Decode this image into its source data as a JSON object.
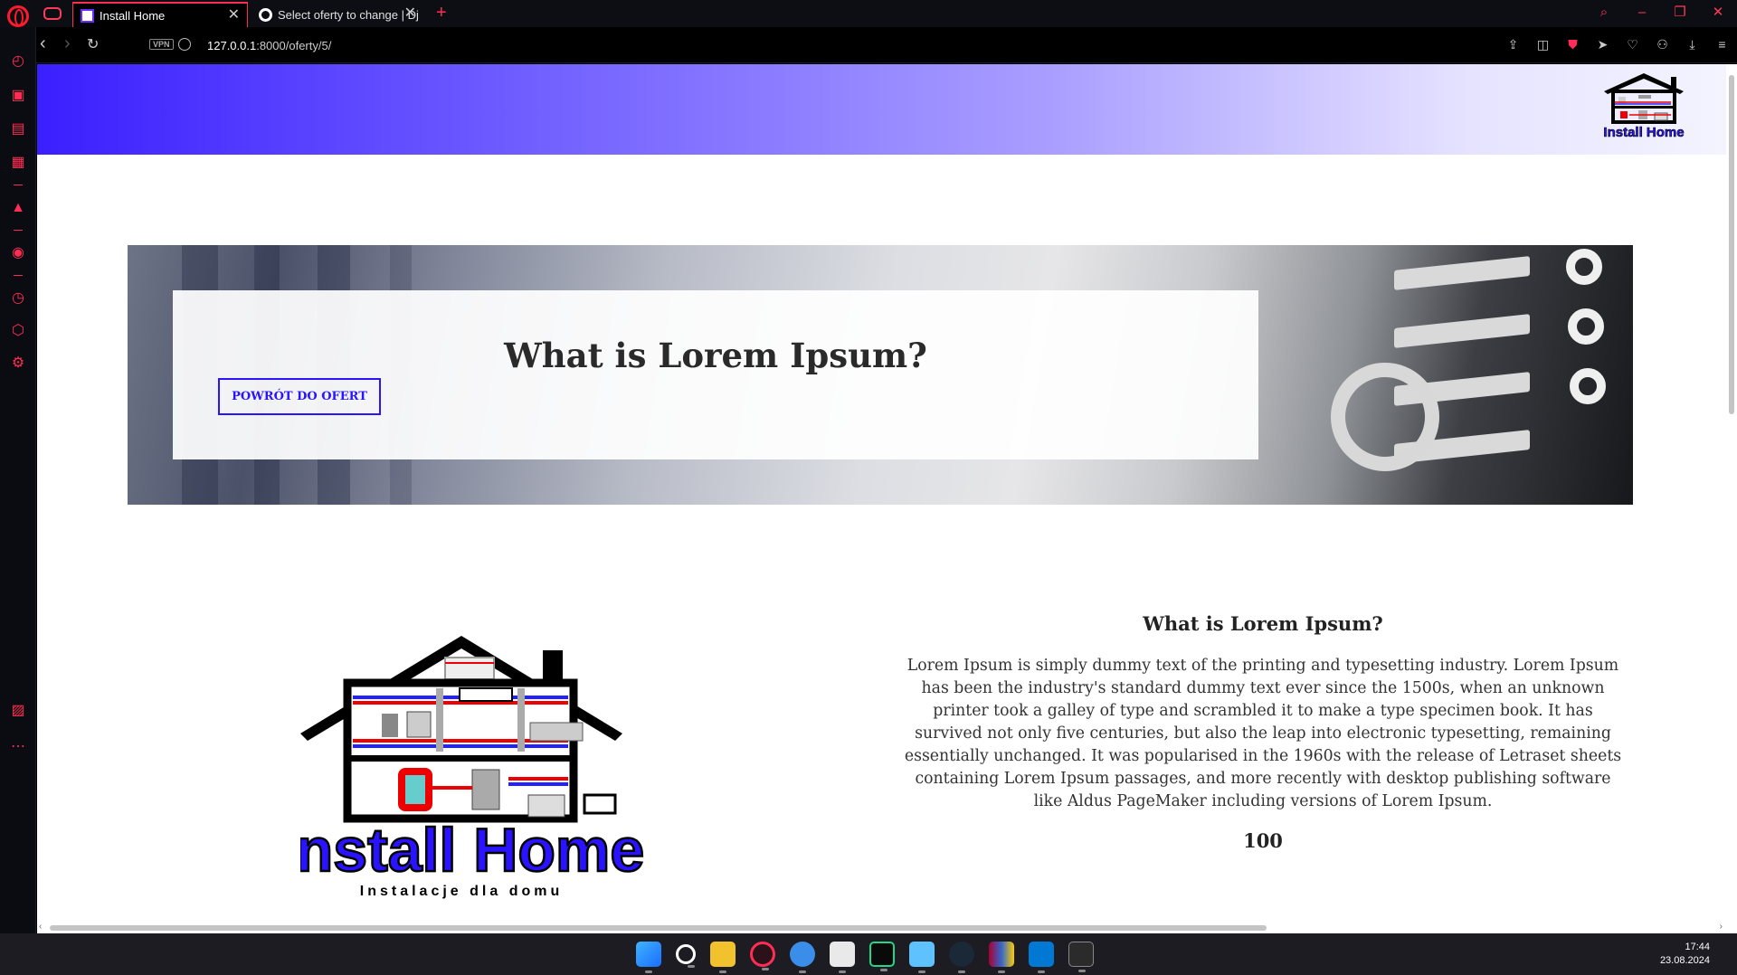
{
  "browser": {
    "tabs": [
      {
        "title": "Install Home",
        "active": true
      },
      {
        "title": "Select oferty to change | Dj",
        "active": false
      }
    ],
    "vpn_label": "VPN",
    "url_host": "127.0.0.1",
    "url_path": ":8000/oferty/5/",
    "accent_color": "#ff2d55"
  },
  "header": {
    "logo_alt": "Install Home logo",
    "gradient_start": "#3b1fff"
  },
  "hero": {
    "title": "What is Lorem Ipsum?",
    "back_button_label": "POWRÓT DO OFERT"
  },
  "logo": {
    "brand": "Install Home",
    "tagline": "Instalacje dla domu",
    "header_brand": "Install Home"
  },
  "content": {
    "title": "What is Lorem Ipsum?",
    "description": "Lorem Ipsum is simply dummy text of the printing and typesetting industry. Lorem Ipsum has been the industry's standard dummy text ever since the 1500s, when an unknown printer took a galley of type and scrambled it to make a type specimen book. It has survived not only five centuries, but also the leap into electronic typesetting, remaining essentially unchanged. It was popularised in the 1960s with the release of Letraset sheets containing Lorem Ipsum passages, and more recently with desktop publishing software like Aldus PageMaker including versions of Lorem Ipsum.",
    "price": "100"
  },
  "taskbar": {
    "time": "17:44",
    "date": "23.08.2024",
    "apps": [
      "windows-start",
      "search",
      "file-explorer",
      "opera-gx",
      "app-blue",
      "app-snipping",
      "pycharm",
      "notepad",
      "steam",
      "winrar",
      "vscode",
      "terminal"
    ]
  }
}
